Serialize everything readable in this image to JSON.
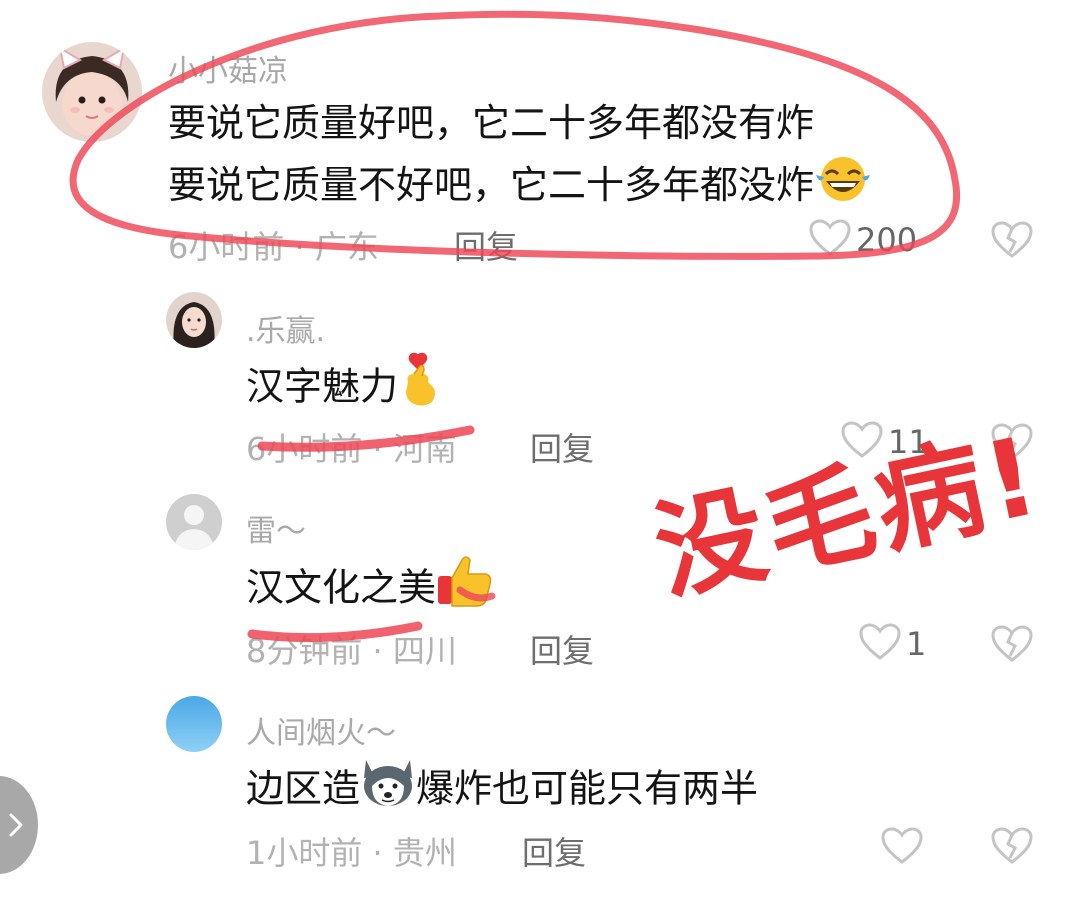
{
  "comments": [
    {
      "username": "小小菇凉",
      "lines": [
        "要说它质量好吧，它二十多年都没有炸",
        "要说它质量不好吧，它二十多年都没炸"
      ],
      "emoji": "laughing-tears-emoji",
      "time_location": "6小时前 · 广东",
      "reply_label": "回复",
      "likes": "200"
    },
    {
      "username": ".乐赢.",
      "text": "汉字魅力",
      "emoji": "finger-heart-emoji",
      "time_location": "6小时前 · 河南",
      "reply_label": "回复",
      "likes": "11"
    },
    {
      "username": "雷～",
      "text": "汉文化之美",
      "emoji": "thumbs-up-emoji",
      "time_location": "8分钟前 · 四川",
      "reply_label": "回复",
      "likes": "1"
    },
    {
      "username": "人间烟火～",
      "text_before": "边区造",
      "emoji": "husky-dog-emoji",
      "text_after": "爆炸也可能只有两半",
      "time_location": "1小时前 · 贵州",
      "reply_label": "回复",
      "likes": ""
    }
  ],
  "annotation_stamp": "没毛病!",
  "colors": {
    "annotation_red": "#e8353a",
    "username_gray": "#a9a9a9",
    "meta_gray": "#b2b2b2",
    "reply_gray": "#6e6e6e",
    "icon_gray": "#c4c4c4"
  }
}
